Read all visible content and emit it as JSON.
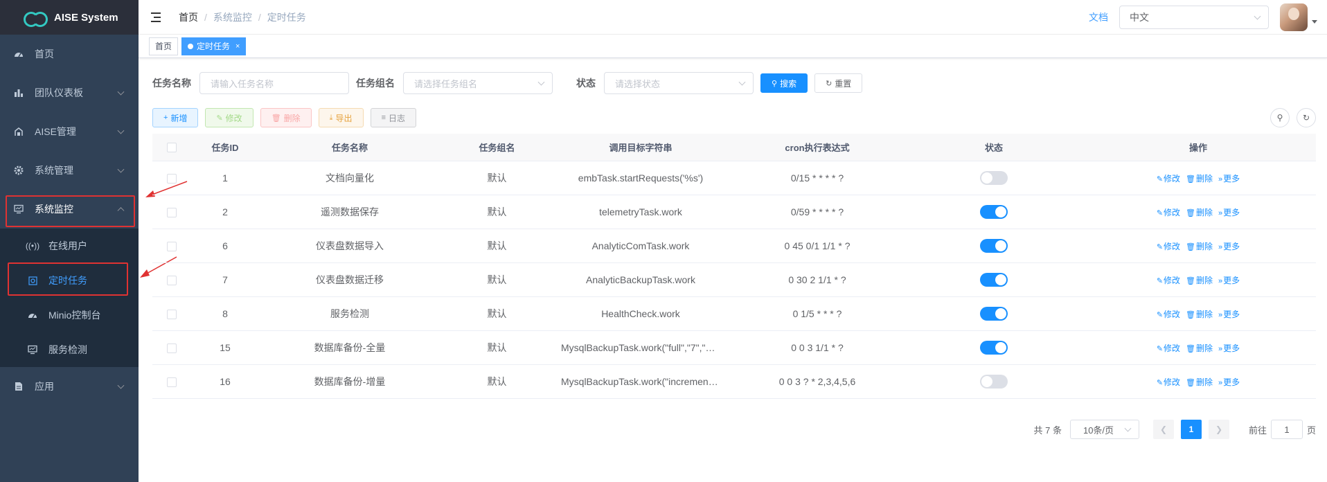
{
  "app": {
    "title": "AISE System"
  },
  "sidebar": {
    "items": [
      {
        "label": "首页",
        "icon": "dashboard-icon"
      },
      {
        "label": "团队仪表板",
        "icon": "bar-chart-icon"
      },
      {
        "label": "AISE管理",
        "icon": "tool-icon"
      },
      {
        "label": "系统管理",
        "icon": "gear-icon"
      },
      {
        "label": "系统监控",
        "icon": "monitor-icon"
      },
      {
        "label": "应用",
        "icon": "document-icon"
      }
    ],
    "submenu": [
      {
        "label": "在线用户",
        "icon": "online-icon"
      },
      {
        "label": "定时任务",
        "icon": "job-icon"
      },
      {
        "label": "Minio控制台",
        "icon": "dashboard-icon"
      },
      {
        "label": "服务检测",
        "icon": "monitor-icon"
      }
    ]
  },
  "navbar": {
    "breadcrumb": [
      "首页",
      "系统监控",
      "定时任务"
    ],
    "doc_link": "文档",
    "language": "中文"
  },
  "tags": {
    "home": "首页",
    "active": "定时任务",
    "close": "×"
  },
  "filters": {
    "name_label": "任务名称",
    "name_placeholder": "请输入任务名称",
    "group_label": "任务组名",
    "group_placeholder": "请选择任务组名",
    "status_label": "状态",
    "status_placeholder": "请选择状态",
    "search": "搜索",
    "reset": "重置"
  },
  "toolbar": {
    "add": "新增",
    "edit": "修改",
    "delete": "删除",
    "export": "导出",
    "log": "日志"
  },
  "table": {
    "headers": [
      "任务ID",
      "任务名称",
      "任务组名",
      "调用目标字符串",
      "cron执行表达式",
      "状态",
      "操作"
    ],
    "rows": [
      {
        "id": "1",
        "name": "文档向量化",
        "group": "默认",
        "target": "embTask.startRequests('%s')",
        "cron": "0/15 * * * * ?",
        "enabled": false
      },
      {
        "id": "2",
        "name": "遥测数据保存",
        "group": "默认",
        "target": "telemetryTask.work",
        "cron": "0/59 * * * * ?",
        "enabled": true
      },
      {
        "id": "6",
        "name": "仪表盘数据导入",
        "group": "默认",
        "target": "AnalyticComTask.work",
        "cron": "0 45 0/1 1/1 * ?",
        "enabled": true
      },
      {
        "id": "7",
        "name": "仪表盘数据迁移",
        "group": "默认",
        "target": "AnalyticBackupTask.work",
        "cron": "0 30 2 1/1 * ?",
        "enabled": true
      },
      {
        "id": "8",
        "name": "服务检测",
        "group": "默认",
        "target": "HealthCheck.work",
        "cron": "0 1/5 * * * ?",
        "enabled": true
      },
      {
        "id": "15",
        "name": "数据库备份-全量",
        "group": "默认",
        "target": "MysqlBackupTask.work(\"full\",\"7\",\"a…",
        "cron": "0 0 3 1/1 * ?",
        "enabled": true
      },
      {
        "id": "16",
        "name": "数据库备份-增量",
        "group": "默认",
        "target": "MysqlBackupTask.work(\"increment…",
        "cron": "0 0 3 ? * 2,3,4,5,6",
        "enabled": false
      }
    ],
    "ops": {
      "edit": "修改",
      "delete": "删除",
      "more": "更多"
    }
  },
  "pagination": {
    "total": "共 7 条",
    "page_size": "10条/页",
    "current": "1",
    "goto_label": "前往",
    "goto_value": "1",
    "page_unit": "页"
  },
  "colors": {
    "sidebar_bg": "#304156",
    "accent": "#1890ff",
    "highlight_box": "#e03232"
  }
}
